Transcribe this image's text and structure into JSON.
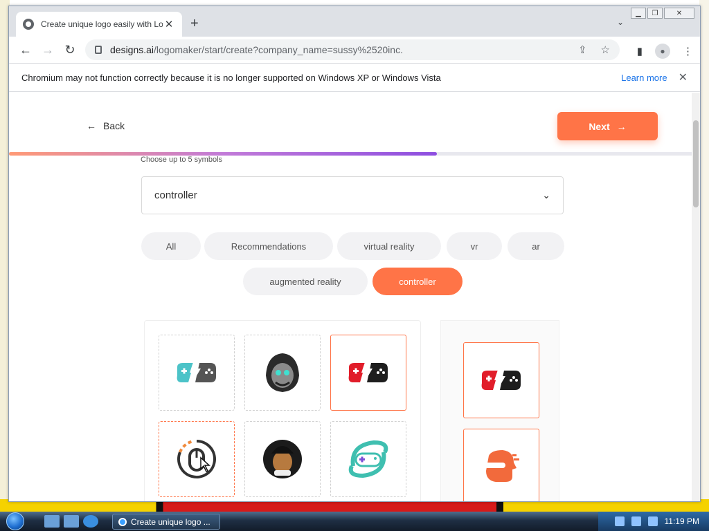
{
  "browser": {
    "tab_title": "Create unique logo easily with Lo",
    "url_host": "designs.ai",
    "url_path": "/logomaker/start/create?company_name=sussy%2520inc.",
    "infobar_message": "Chromium may not function correctly because it is no longer supported on Windows XP or Windows Vista",
    "infobar_link": "Learn more"
  },
  "page": {
    "back_label": "Back",
    "next_label": "Next",
    "progress_fraction": 0.625,
    "hint": "Choose up to 5 symbols",
    "search_value": "controller",
    "chips": [
      {
        "label": "All",
        "active": false
      },
      {
        "label": "Recommendations",
        "active": false
      },
      {
        "label": "virtual reality",
        "active": false
      },
      {
        "label": "vr",
        "active": false
      },
      {
        "label": "ar",
        "active": false
      },
      {
        "label": "augmented reality",
        "active": false
      },
      {
        "label": "controller",
        "active": true
      }
    ],
    "symbols": [
      {
        "icon": "teal-gamepad-lightning-icon",
        "state": "default"
      },
      {
        "icon": "hooded-gamer-mascot-icon",
        "state": "default"
      },
      {
        "icon": "red-black-gamepad-lightning-icon",
        "state": "selected"
      },
      {
        "icon": "mouse-circle-icon",
        "state": "hover"
      },
      {
        "icon": "afro-gamer-mascot-icon",
        "state": "default"
      },
      {
        "icon": "teal-gamepad-orbit-icon",
        "state": "default"
      }
    ],
    "selected_symbols": [
      {
        "icon": "red-black-gamepad-lightning-icon"
      },
      {
        "icon": "orange-speed-head-icon"
      }
    ]
  },
  "taskbar": {
    "active_window": "Create unique logo ...",
    "clock": "11:19 PM"
  },
  "colors": {
    "accent": "#ff7447",
    "progress_start": "#ff9a76",
    "progress_end": "#8d4ee0"
  }
}
